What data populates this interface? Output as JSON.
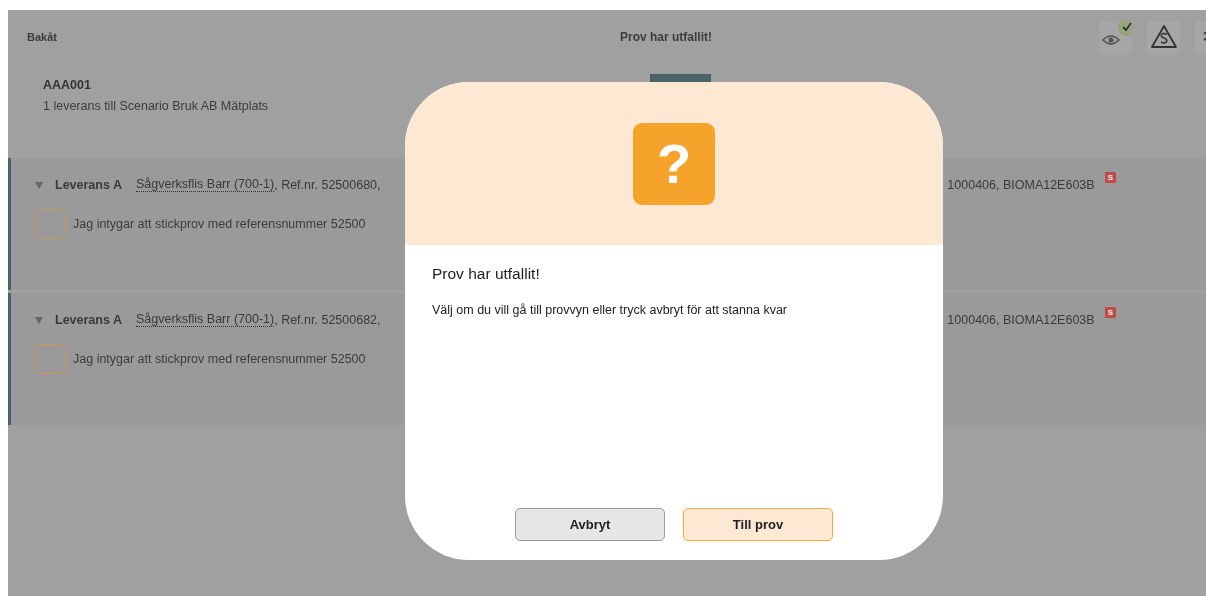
{
  "header": {
    "back": "Bakåt",
    "title": "Prov har utfallit!"
  },
  "order": {
    "id": "AAA001",
    "subtitle": "1 leverans till Scenario Bruk AB Mätplats"
  },
  "deliveries": [
    {
      "expanded": true,
      "name": "Leverans A",
      "product": "Sågverksflis Barr (700-1)",
      "ref": ", Ref.nr. 52500680,",
      "tail": "1000406, BIOMA12E603B",
      "badge": "S",
      "checkbox": {
        "label": "Jag intygar att stickprov med referensnummer 52500",
        "checked": false
      }
    },
    {
      "expanded": true,
      "name": "Leverans A",
      "product": "Sågverksflis Barr (700-1)",
      "ref": ", Ref.nr. 52500682,",
      "tail": "1000406, BIOMA12E603B",
      "badge": "S",
      "checkbox": {
        "label": "Jag intygar att stickprov med referensnummer 52500",
        "checked": false
      }
    }
  ],
  "dialog": {
    "icon": "?",
    "title": "Prov har utfallit!",
    "message": "Välj om du vill gå till provvyn eller tryck avbryt för att stanna kvar",
    "buttons": [
      {
        "label": "Avbryt",
        "kind": "secondary"
      },
      {
        "label": "Till prov",
        "kind": "primary"
      }
    ]
  }
}
